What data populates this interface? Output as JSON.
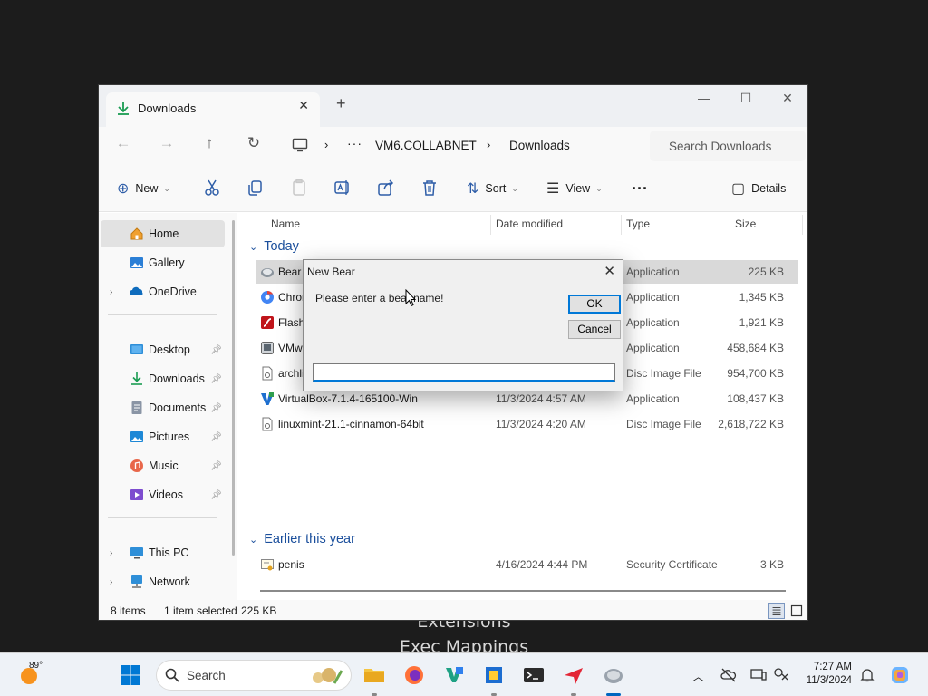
{
  "background": {
    "line1": "Extensions",
    "line2": "Exec Mappings"
  },
  "explorer": {
    "tab_title": "Downloads",
    "tab_close": "✕",
    "new_tab": "+",
    "win_minimize": "—",
    "win_maximize": "☐",
    "win_close": "✕",
    "breadcrumb": [
      "VM6.COLLABNET",
      "Downloads"
    ],
    "breadcrumb_more": "···",
    "search_placeholder": "Search Downloads",
    "toolbar": {
      "new_label": "New",
      "sort_label": "Sort",
      "view_label": "View",
      "more_label": "···",
      "details_label": "Details"
    },
    "sidebar": {
      "home": "Home",
      "gallery": "Gallery",
      "onedrive": "OneDrive",
      "desktop": "Desktop",
      "downloads": "Downloads",
      "documents": "Documents",
      "pictures": "Pictures",
      "music": "Music",
      "videos": "Videos",
      "thispc": "This PC",
      "network": "Network"
    },
    "columns": {
      "name": "Name",
      "date": "Date modified",
      "type": "Type",
      "size": "Size"
    },
    "groups": {
      "today": "Today",
      "earlier": "Earlier this year"
    },
    "files": [
      {
        "name": "Bear",
        "date": "",
        "type": "Application",
        "size": "225 KB",
        "icon": "bear-app-icon"
      },
      {
        "name": "Chrom",
        "date": "",
        "type": "Application",
        "size": "1,345 KB",
        "icon": "chrome-icon"
      },
      {
        "name": "Flash",
        "date": "",
        "type": "Application",
        "size": "1,921 KB",
        "icon": "flash-icon"
      },
      {
        "name": "VMwa",
        "date": "",
        "type": "Application",
        "size": "458,684 KB",
        "icon": "vmware-icon"
      },
      {
        "name": "archli",
        "date": "",
        "type": "Disc Image File",
        "size": "954,700 KB",
        "icon": "disc-image-icon"
      },
      {
        "name": "VirtualBox-7.1.4-165100-Win",
        "date": "11/3/2024 4:57 AM",
        "type": "Application",
        "size": "108,437 KB",
        "icon": "virtualbox-icon"
      },
      {
        "name": "linuxmint-21.1-cinnamon-64bit",
        "date": "11/3/2024 4:20 AM",
        "type": "Disc Image File",
        "size": "2,618,722 KB",
        "icon": "disc-image-icon"
      }
    ],
    "earlier_files": [
      {
        "name": "penis",
        "date": "4/16/2024 4:44 PM",
        "type": "Security Certificate",
        "size": "3 KB",
        "icon": "certificate-icon"
      }
    ],
    "status": {
      "items": "8 items",
      "selected": "1 item selected",
      "selected_size": "225 KB"
    }
  },
  "dialog": {
    "title": "New Bear",
    "close": "✕",
    "message": "Please enter a bear name!",
    "ok": "OK",
    "cancel": "Cancel",
    "input_value": ""
  },
  "taskbar": {
    "weather_temp": "89°",
    "search_label": "Search",
    "time": "7:27 AM",
    "date": "11/3/2024"
  },
  "colors": {
    "accent": "#0078d7",
    "folder_blue": "#1b4f9c"
  }
}
